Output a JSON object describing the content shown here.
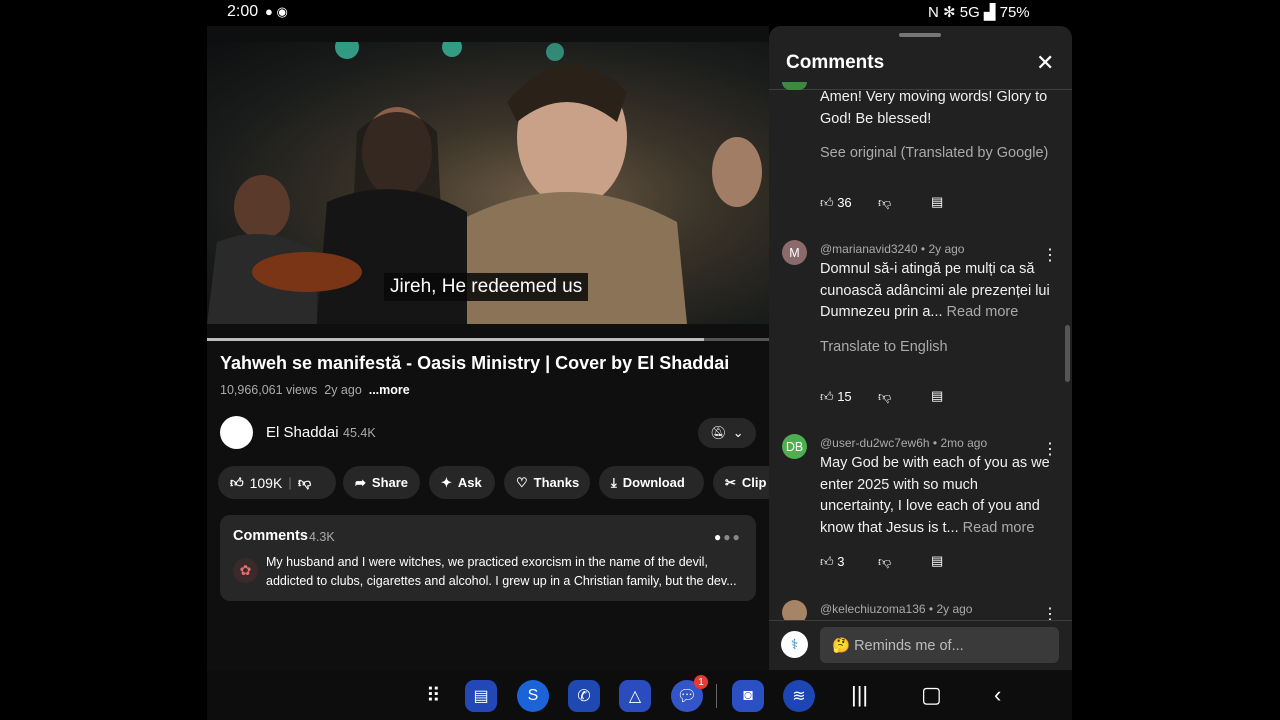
{
  "status_bar": {
    "time": "2:00",
    "right": "N ✻ 5G ▟ 75%"
  },
  "video": {
    "subtitle": "Jireh, He redeemed us",
    "progress": 0.885
  },
  "video_info": {
    "title": "Yahweh se manifestă - Oasis Ministry | Cover by El Shaddai",
    "views": "10,966,061 views",
    "age": "2y ago",
    "more": "...more"
  },
  "channel": {
    "name": "El Shaddai",
    "subs": "45.4K"
  },
  "actions": {
    "likes": "109K",
    "share": "Share",
    "ask": "Ask",
    "thanks": "Thanks",
    "download": "Download",
    "clip": "Clip"
  },
  "comments_box": {
    "title": "Comments",
    "count": "4.3K",
    "text": "My husband and I were witches, we practiced exorcism in the name of the devil, addicted to clubs, cigarettes and alcohol. I grew up in a Christian family, but the dev..."
  },
  "panel": {
    "title": "Comments",
    "comments": [
      {
        "text": "Amen! Very moving words! Glory to God! Be blessed!",
        "link": "See original (Translated by Google)",
        "likes": "36"
      },
      {
        "avatar": "M",
        "author": "@marianavid3240",
        "age": "2y ago",
        "text": "Domnul să-i atingă pe mulți ca să cunoască adâncimi ale prezenței lui Dumnezeu prin a...",
        "read_more": "Read more",
        "link": "Translate to English",
        "likes": "15"
      },
      {
        "avatar": "DB",
        "author": "@user-du2wc7ew6h",
        "age": "2mo ago",
        "text": "May God be with each of you as we enter 2025 with so much uncertainty, I love each of you and know that Jesus is t...",
        "read_more": "Read more",
        "likes": "3"
      },
      {
        "author": "@kelechiuzoma136",
        "age": "2y ago"
      }
    ],
    "input_placeholder": "🤔 Reminds me of..."
  },
  "dock": {
    "badge": "1"
  }
}
